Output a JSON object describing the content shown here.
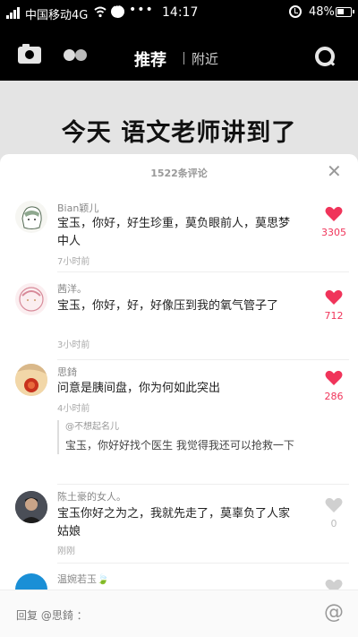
{
  "status_bar": {
    "carrier": "中国移动4G",
    "dots": "•••",
    "time": "14:17",
    "battery": "48%"
  },
  "top_nav": {
    "tab_recommend": "推荐",
    "tab_nearby": "附近"
  },
  "video": {
    "caption": "今天 语文老师讲到了"
  },
  "sheet": {
    "count_label": "1522条评论",
    "close": "✕"
  },
  "comments": [
    {
      "username": "Bian颖儿",
      "text": "宝玉，你好，好生珍重，莫负眼前人，莫思梦中人",
      "time": "7小时前",
      "likes": "3305",
      "liked": true
    },
    {
      "username": "茜洋。",
      "text": "宝玉，你好，好，好像压到我的氧气管子了",
      "time": "3小时前",
      "likes": "712",
      "liked": true
    },
    {
      "username": "思錡",
      "text": "问意是胰间盘，你为何如此突出",
      "time": "4小时前",
      "likes": "286",
      "liked": true,
      "reply": {
        "user": "@不想起名儿",
        "text": "宝玉，你好好找个医生 我觉得我还可以抢救一下"
      }
    },
    {
      "username": "陈土豪的女人。",
      "text": "宝玉你好之为之，我就先走了，莫辜负了人家姑娘",
      "time": "刚刚",
      "likes": "0",
      "liked": false
    },
    {
      "username": "温婉若玉🍃",
      "text": "",
      "time": "",
      "likes": "",
      "liked": false
    }
  ],
  "input_bar": {
    "placeholder": "回复 @思錡 ：",
    "at_symbol": "@"
  },
  "colors": {
    "like_red": "#f0345a",
    "like_gray": "#d0d0d0"
  }
}
